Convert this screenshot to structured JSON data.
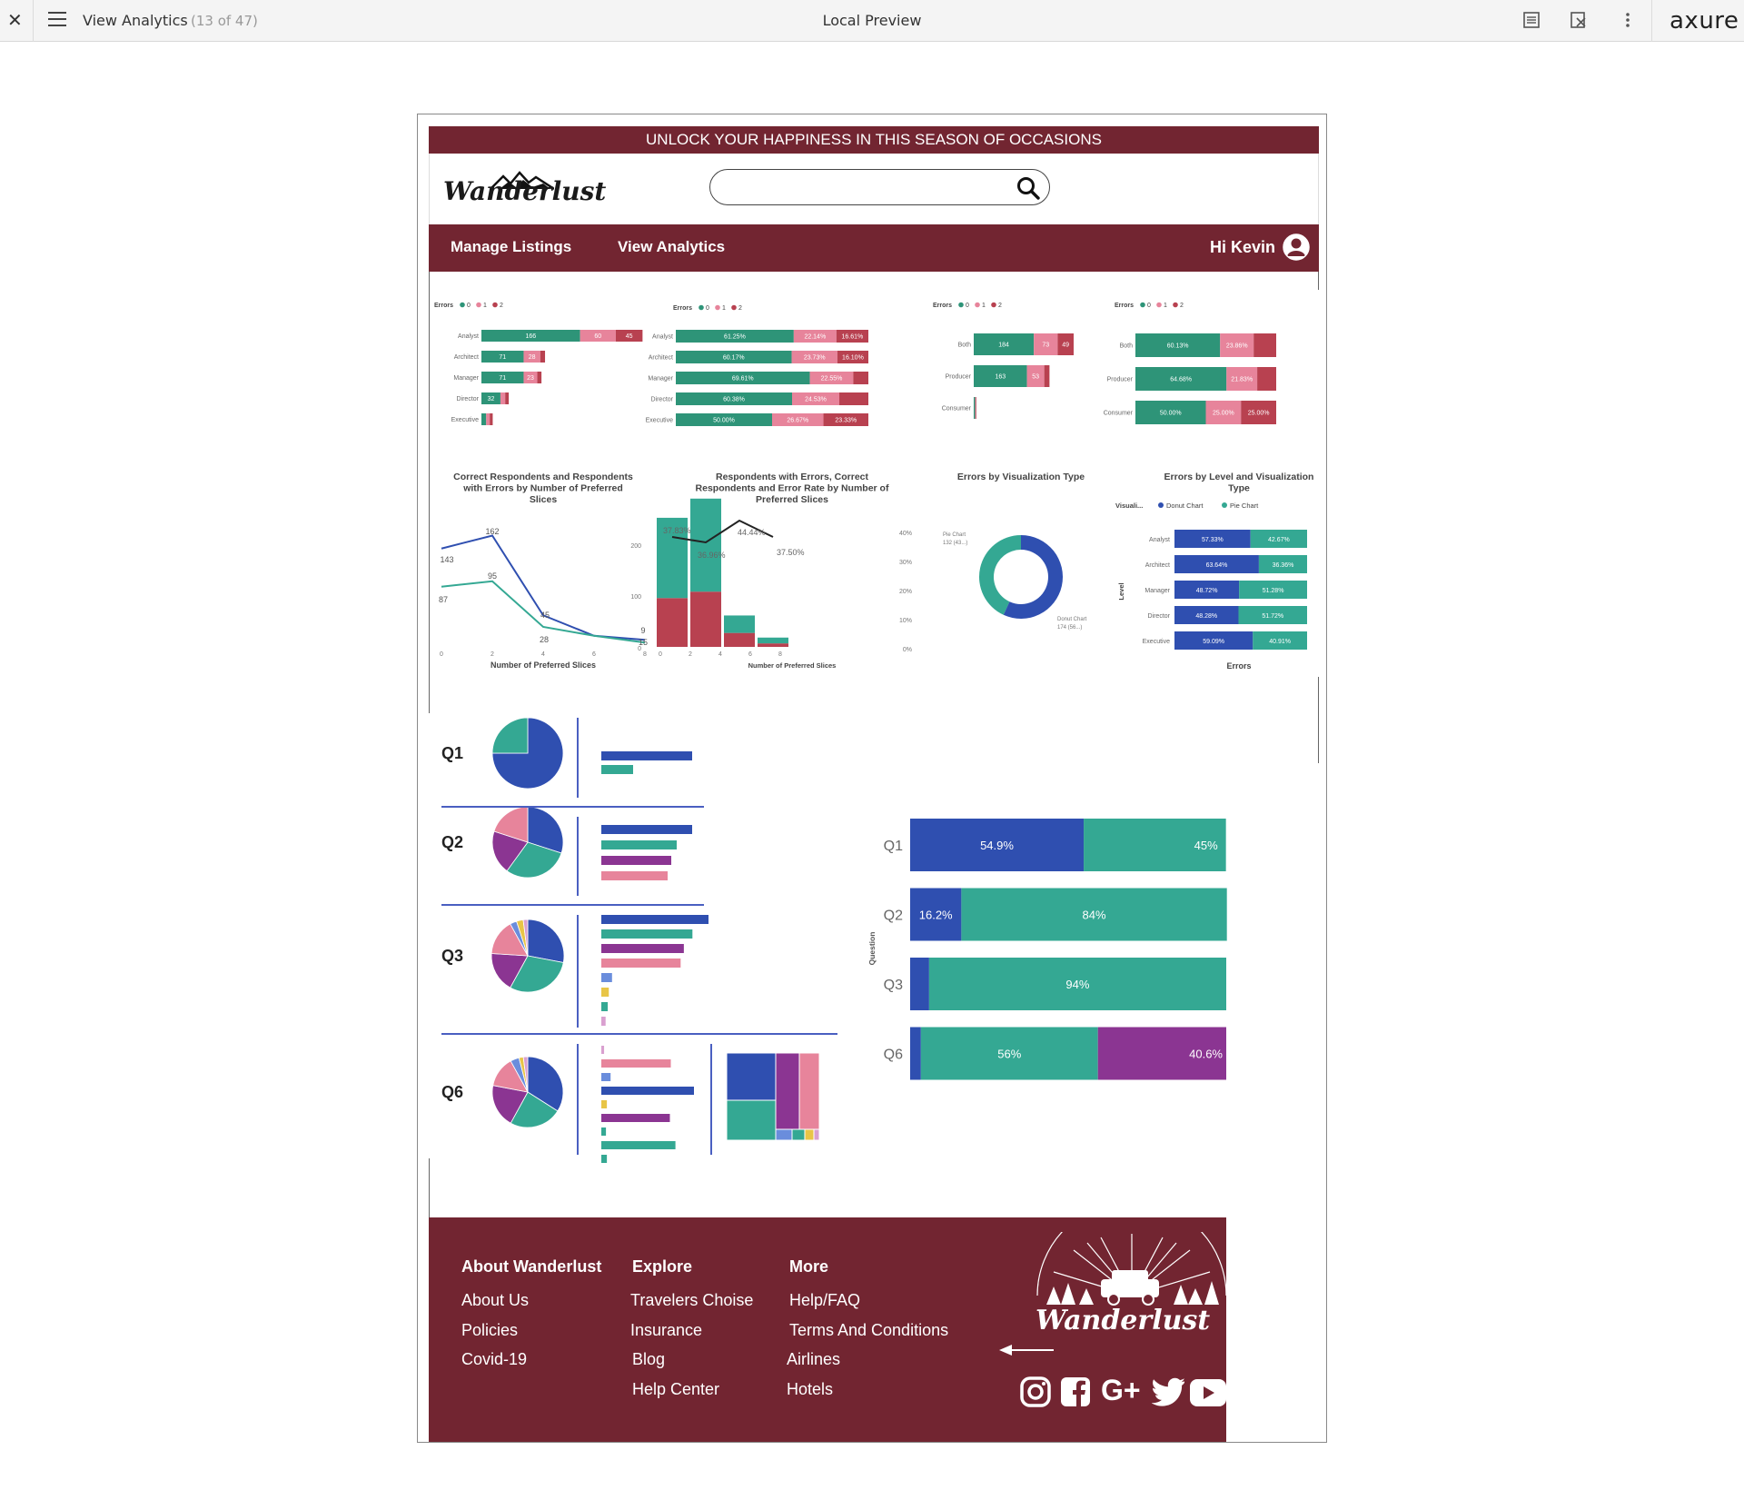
{
  "viewer": {
    "page_name": "View Analytics",
    "page_count": "(13 of 47)",
    "title": "Local Preview",
    "logo": "axure"
  },
  "site": {
    "banner": "UNLOCK YOUR HAPPINESS IN THIS SEASON OF OCCASIONS",
    "brand": "Wanderlust",
    "search_placeholder": "",
    "nav": {
      "manage": "Manage Listings",
      "analytics": "View Analytics",
      "greeting": "Hi Kevin"
    }
  },
  "colors": {
    "brand": "#722531",
    "teal": "#2e9478",
    "pink": "#e7849b",
    "red": "#b84150",
    "blue": "#2f4fb0",
    "bright_teal": "#34a893",
    "purple": "#8b3592"
  },
  "charts_top": {
    "legend": {
      "label": "Errors",
      "items": [
        "0",
        "1",
        "2"
      ]
    },
    "c1": {
      "categories": [
        "Analyst",
        "Architect",
        "Manager",
        "Director",
        "Executive"
      ],
      "s0": [
        166,
        71,
        71,
        32,
        0
      ],
      "s1": [
        60,
        28,
        23,
        0,
        0
      ],
      "s2": [
        45,
        0,
        0,
        0,
        0
      ],
      "labels0": [
        "166",
        "71",
        "71",
        "32",
        ""
      ],
      "labels1": [
        "60",
        "28",
        "23",
        "",
        ""
      ],
      "labels2": [
        "45",
        "",
        "",
        "",
        ""
      ],
      "raw": [
        [
          166,
          60,
          45
        ],
        [
          71,
          28,
          8
        ],
        [
          71,
          23,
          7
        ],
        [
          32,
          8,
          6
        ],
        [
          8,
          6,
          5
        ]
      ]
    },
    "c2": {
      "categories": [
        "Analyst",
        "Architect",
        "Manager",
        "Director",
        "Executive"
      ],
      "labels": [
        [
          "61.25%",
          "22.14%",
          "16.61%"
        ],
        [
          "60.17%",
          "23.73%",
          "16.10%"
        ],
        [
          "69.61%",
          "22.55%",
          ""
        ],
        [
          "60.38%",
          "24.53%",
          ""
        ],
        [
          "50.00%",
          "26.67%",
          "23.33%"
        ]
      ],
      "raw": [
        [
          61.25,
          22.14,
          16.61
        ],
        [
          60.17,
          23.73,
          16.1
        ],
        [
          69.61,
          22.55,
          7.84
        ],
        [
          60.38,
          24.53,
          15.09
        ],
        [
          50.0,
          26.67,
          23.33
        ]
      ]
    },
    "c3": {
      "categories": [
        "Both",
        "Producer",
        "Consumer"
      ],
      "labels": [
        [
          "184",
          "73",
          "49"
        ],
        [
          "163",
          "53",
          ""
        ],
        [
          "",
          "",
          ""
        ]
      ],
      "raw": [
        [
          184,
          73,
          49
        ],
        [
          163,
          53,
          16
        ],
        [
          4,
          2,
          2
        ]
      ]
    },
    "c4": {
      "categories": [
        "Both",
        "Producer",
        "Consumer"
      ],
      "labels": [
        [
          "60.13%",
          "23.86%",
          ""
        ],
        [
          "64.68%",
          "21.83%",
          ""
        ],
        [
          "50.00%",
          "25.00%",
          "25.00%"
        ]
      ],
      "raw": [
        [
          60.13,
          23.86,
          16.01
        ],
        [
          64.68,
          21.83,
          13.49
        ],
        [
          50.0,
          25.0,
          25.0
        ]
      ]
    }
  },
  "charts_mid": {
    "line": {
      "title": "Correct Respondents and Respondents with Errors by Number of Preferred Slices",
      "xlabel": "Number of Preferred Slices",
      "ticks": [
        "0",
        "2",
        "4",
        "6",
        "8"
      ],
      "labels": [
        "162",
        "143",
        "95",
        "87",
        "45",
        "28",
        "9",
        "15"
      ],
      "s1": [
        143,
        162,
        45,
        15,
        9
      ],
      "s2": [
        87,
        95,
        28,
        15,
        5
      ]
    },
    "combo": {
      "title": "Respondents with Errors, Correct Respondents and Error Rate by Number of Preferred Slices",
      "xlabel": "Number of Preferred Slices",
      "yticks": [
        "200",
        "100",
        "0"
      ],
      "y2ticks": [
        "40%",
        "30%",
        "20%",
        "10%",
        "0%"
      ],
      "xticks": [
        "0",
        "2",
        "4",
        "6",
        "8"
      ],
      "rate_labels": [
        "37.83%",
        "36.96%",
        "44.44%",
        "37.50%"
      ],
      "correct": [
        138,
        160,
        30,
        10
      ],
      "errors": [
        84,
        95,
        24,
        6
      ]
    },
    "donut": {
      "title": "Errors by Visualization Type",
      "pie_label": "Pie Chart",
      "pie_value": "132 (43...)",
      "donut_label": "Donut Chart",
      "donut_value": "174 (56...)",
      "values": [
        132,
        174
      ]
    },
    "stack": {
      "title": "Errors by Level and Visualization Type",
      "legend_title": "Visuali...",
      "legend": [
        "Donut Chart",
        "Pie Chart"
      ],
      "ylabel": "Level",
      "xlabel": "Errors",
      "categories": [
        "Analyst",
        "Architect",
        "Manager",
        "Director",
        "Executive"
      ],
      "donut": [
        57.33,
        63.64,
        48.72,
        48.28,
        59.09
      ],
      "pie": [
        42.67,
        36.36,
        51.28,
        51.72,
        40.91
      ],
      "donut_labels": [
        "57.33%",
        "63.64%",
        "48.72%",
        "48.28%",
        "59.09%"
      ],
      "pie_labels": [
        "42.67%",
        "36.36%",
        "51.28%",
        "51.72%",
        "40.91%"
      ]
    }
  },
  "questions": {
    "rows": [
      {
        "label": "Q1",
        "pie": [
          75,
          25
        ],
        "bars": [
          100,
          35
        ]
      },
      {
        "label": "Q2",
        "pie": [
          30,
          30,
          20,
          20
        ],
        "bars": [
          100,
          83,
          77,
          73
        ]
      },
      {
        "label": "Q3",
        "pie": [
          28,
          30,
          18,
          16,
          3,
          3,
          2
        ],
        "bars": [
          100,
          85,
          77,
          74,
          10,
          7,
          6,
          4
        ]
      },
      {
        "label": "Q6",
        "pie": [
          34,
          24,
          20,
          14,
          4,
          2,
          2
        ],
        "bars": [
          3,
          75,
          10,
          100,
          6,
          74,
          5,
          80,
          6
        ]
      }
    ],
    "summary": {
      "ylabel": "Question",
      "rows": [
        {
          "q": "Q1",
          "blue": 54.9,
          "teal": 45.0,
          "purple": 0,
          "labels": [
            "54.9%",
            "45%",
            ""
          ]
        },
        {
          "q": "Q2",
          "blue": 16.2,
          "teal": 84.0,
          "purple": 0,
          "labels": [
            "16.2%",
            "84%",
            ""
          ]
        },
        {
          "q": "Q3",
          "blue": 6.0,
          "teal": 94.0,
          "purple": 0,
          "labels": [
            "",
            "94%",
            ""
          ]
        },
        {
          "q": "Q6",
          "blue": 3.4,
          "teal": 56.0,
          "purple": 40.6,
          "labels": [
            "",
            "56%",
            "40.6%"
          ]
        }
      ]
    }
  },
  "footer": {
    "col1": {
      "title": "About Wanderlust",
      "links": [
        "About Us",
        "Policies",
        "Covid-19"
      ]
    },
    "col2": {
      "title": "Explore",
      "links": [
        "Travelers Choise",
        "Insurance",
        "Blog",
        "Help Center"
      ]
    },
    "col3": {
      "title": "More",
      "links": [
        "Help/FAQ",
        "Terms And Conditions",
        "Airlines",
        "Hotels"
      ]
    },
    "brand": "Wanderlust",
    "social": [
      "instagram-icon",
      "facebook-icon",
      "google-plus-icon",
      "twitter-icon",
      "youtube-icon"
    ],
    "gplus": "G+"
  }
}
